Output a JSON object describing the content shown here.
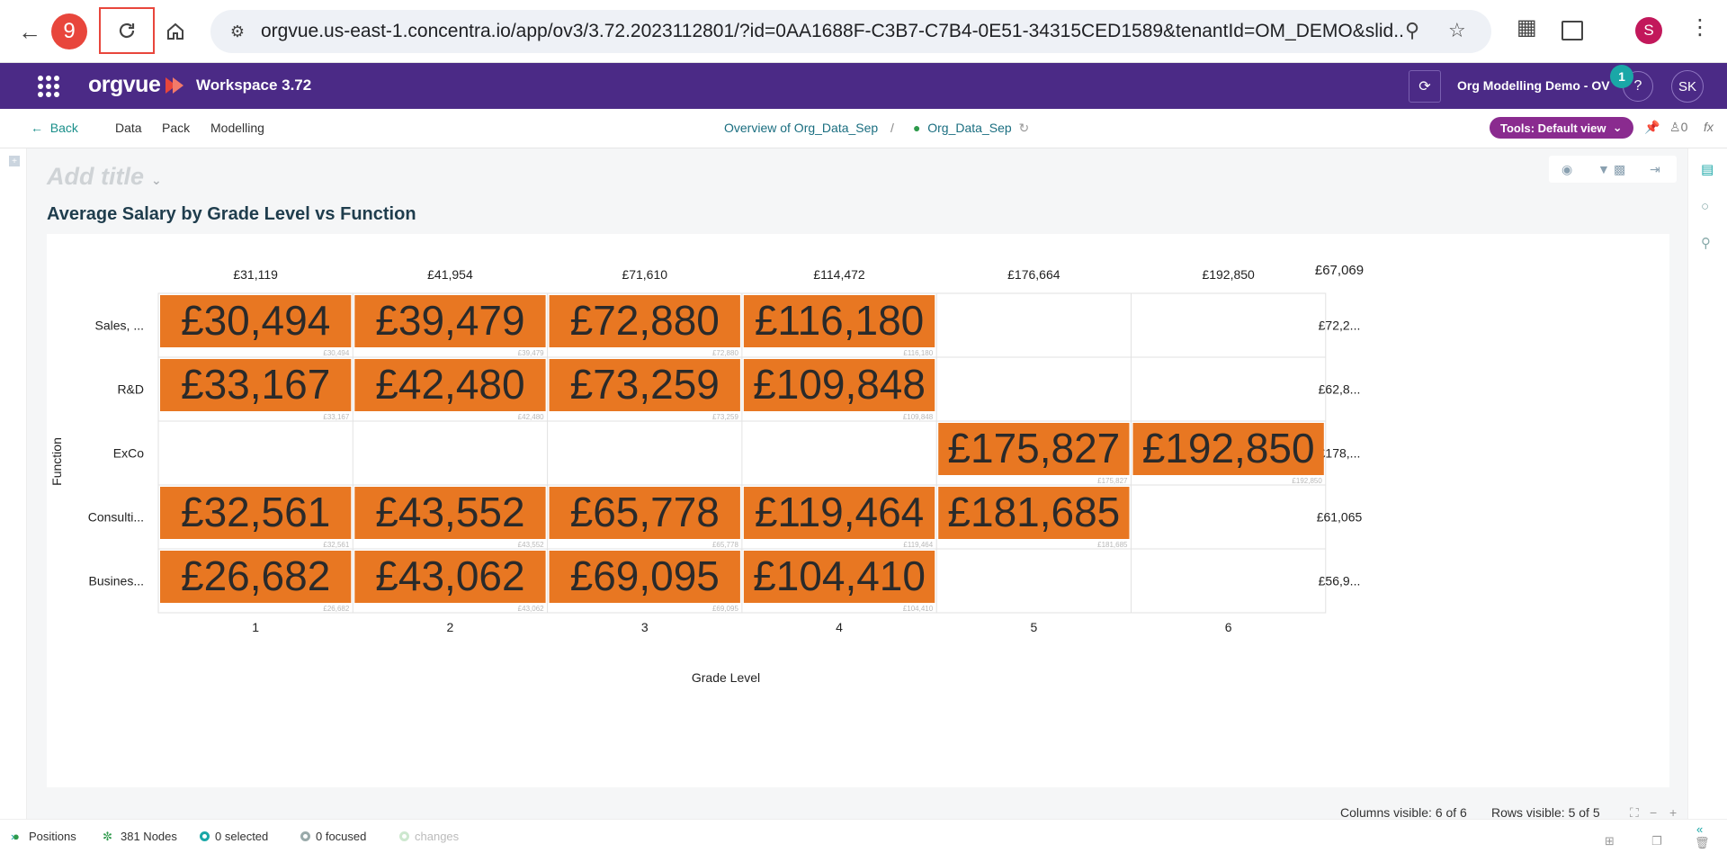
{
  "browser": {
    "step_badge": "9",
    "url": "orgvue.us-east-1.concentra.io/app/ov3/3.72.2023112801/?id=0AA1688F-C3B7-C7B4-0E51-34315CED1589&tenantId=OM_DEMO&slid...",
    "profile_initial": "S"
  },
  "header": {
    "logo": "orgvue",
    "workspace": "Workspace  3.72",
    "project": "Org Modelling Demo - OV",
    "notification_count": "1",
    "help": "?",
    "user_initials": "SK"
  },
  "subnav": {
    "back": "Back",
    "items": [
      "Data",
      "Pack",
      "Modelling"
    ],
    "breadcrumb_parent": "Overview of Org_Data_Sep",
    "breadcrumb_sep": "/",
    "breadcrumb_current": "Org_Data_Sep",
    "tools_label": "Tools: Default view",
    "person_count": "0"
  },
  "main": {
    "add_title": "Add title",
    "chart_title": "Average Salary by Grade Level vs Function"
  },
  "chart_data": {
    "type": "heatmap",
    "title": "Average Salary by Grade Level vs Function",
    "xlabel": "Grade Level",
    "ylabel": "Function",
    "columns": [
      "1",
      "2",
      "3",
      "4",
      "5",
      "6"
    ],
    "column_totals": [
      "£31,119",
      "£41,954",
      "£71,610",
      "£114,472",
      "£176,664",
      "£192,850"
    ],
    "grand_total": "£67,069",
    "rows": [
      "Sales, ...",
      "R&D",
      "ExCo",
      "Consulti...",
      "Busines..."
    ],
    "row_totals": [
      "£72,2...",
      "£62,8...",
      "£178,...",
      "£61,065",
      "£56,9..."
    ],
    "cells": [
      [
        "£30,494",
        "£39,479",
        "£72,880",
        "£116,180",
        null,
        null
      ],
      [
        "£33,167",
        "£42,480",
        "£73,259",
        "£109,848",
        null,
        null
      ],
      [
        null,
        null,
        null,
        null,
        "£175,827",
        "£192,850"
      ],
      [
        "£32,561",
        "£43,552",
        "£65,778",
        "£119,464",
        "£181,685",
        null
      ],
      [
        "£26,682",
        "£43,062",
        "£69,095",
        "£104,410",
        null,
        null
      ]
    ],
    "cell_color": "#e87722"
  },
  "status": {
    "positions": "Positions",
    "nodes": "381 Nodes",
    "selected": "0 selected",
    "focused": "0 focused",
    "changes": "changes",
    "columns_visible": "Columns visible: 6 of 6",
    "rows_visible": "Rows visible: 5 of 5"
  }
}
